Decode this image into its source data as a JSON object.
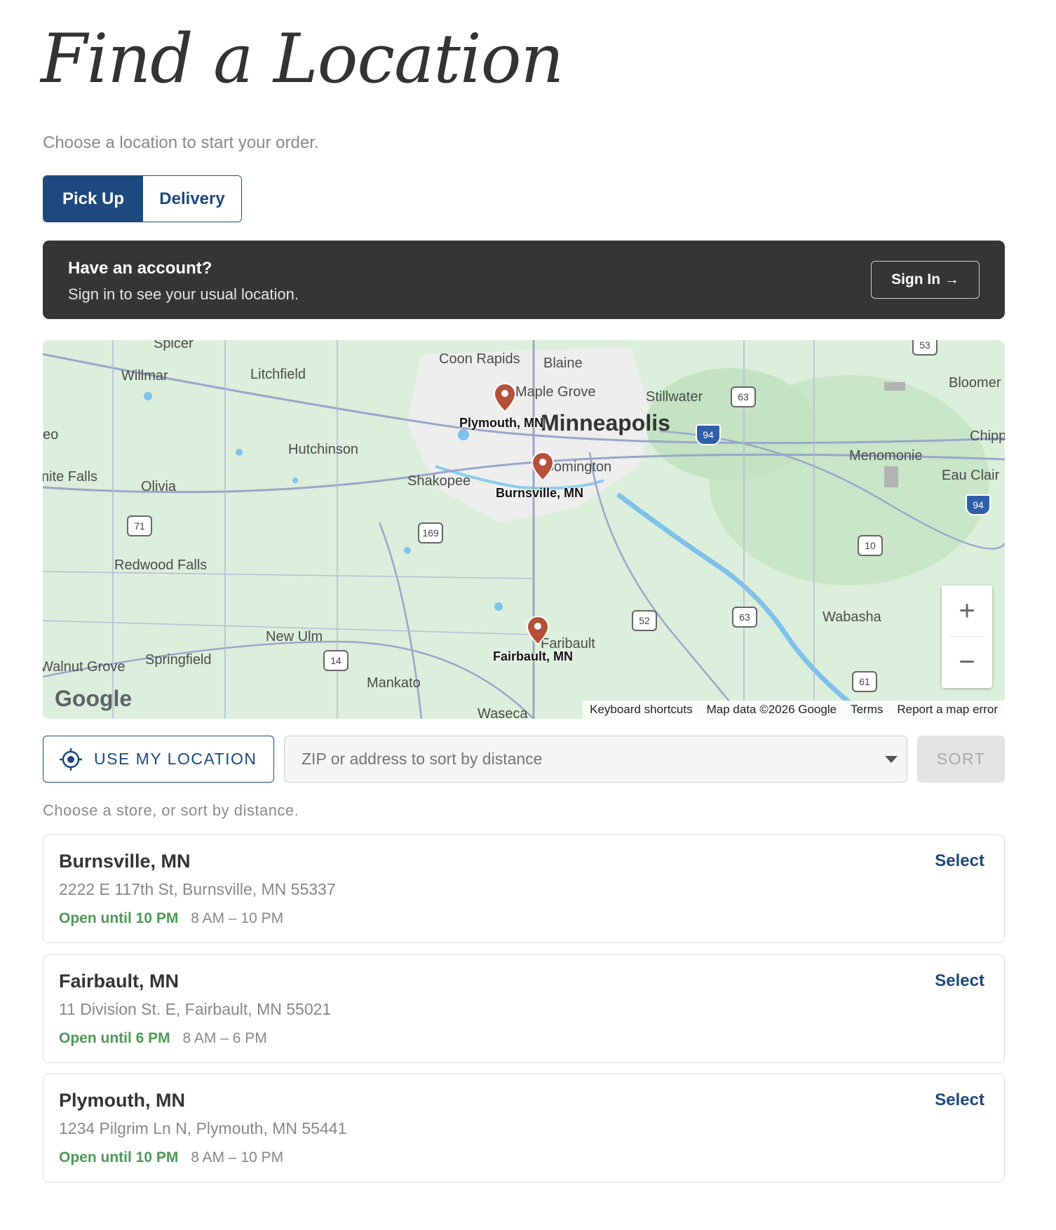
{
  "header": {
    "title": "Find a Location",
    "subtitle": "Choose a location to start your order."
  },
  "order_mode": {
    "options": [
      "Pick Up",
      "Delivery"
    ],
    "selected": "Pick Up"
  },
  "account_banner": {
    "title": "Have an account?",
    "subtitle": "Sign in to see your usual location.",
    "button": "Sign In →"
  },
  "map": {
    "labels": [
      "Spicer",
      "Willmar",
      "Litchfield",
      "Coon Rapids",
      "Blaine",
      "Maple Grove",
      "Stillwater",
      "Bloomer",
      "Hutchinson",
      "Shakopee",
      "Bloomington",
      "Menomonie",
      "Chipp",
      "Eau Clair",
      "nite Falls",
      "Olivia",
      "Redwood Falls",
      "New Ulm",
      "Springfield",
      "Walnut Grove",
      "Mankato",
      "Faribault",
      "Wabasha",
      "Waseca",
      "eo"
    ],
    "big_city": "Minneapolis",
    "pins": [
      "Plymouth, MN",
      "Burnsville, MN",
      "Fairbault, MN"
    ],
    "shields": [
      "63",
      "94",
      "53",
      "71",
      "169",
      "52",
      "63",
      "10",
      "14",
      "61",
      "94"
    ],
    "logo": "Google",
    "attribution": [
      "Keyboard shortcuts",
      "Map data ©2026 Google",
      "Terms",
      "Report a map error"
    ],
    "zoom_in": "+",
    "zoom_out": "−"
  },
  "search": {
    "use_location": "USE MY LOCATION",
    "placeholder": "ZIP or address to sort by distance",
    "sort_button": "SORT",
    "hint": "Choose a store, or sort by distance."
  },
  "stores": [
    {
      "name": "Burnsville, MN",
      "address": "2222 E 117th St, Burnsville, MN 55337",
      "status": "Open until 10 PM",
      "hours": "8 AM – 10 PM",
      "action": "Select"
    },
    {
      "name": "Fairbault, MN",
      "address": "11 Division St. E, Fairbault, MN 55021",
      "status": "Open until 6 PM",
      "hours": "8 AM – 6 PM",
      "action": "Select"
    },
    {
      "name": "Plymouth, MN",
      "address": "1234 Pilgrim Ln N, Plymouth, MN 55441",
      "status": "Open until 10 PM",
      "hours": "8 AM – 10 PM",
      "action": "Select"
    }
  ],
  "colors": {
    "brand": "#1d4a7e",
    "banner": "#353535",
    "open_status": "#4c9a56",
    "pin": "#b5503a"
  }
}
